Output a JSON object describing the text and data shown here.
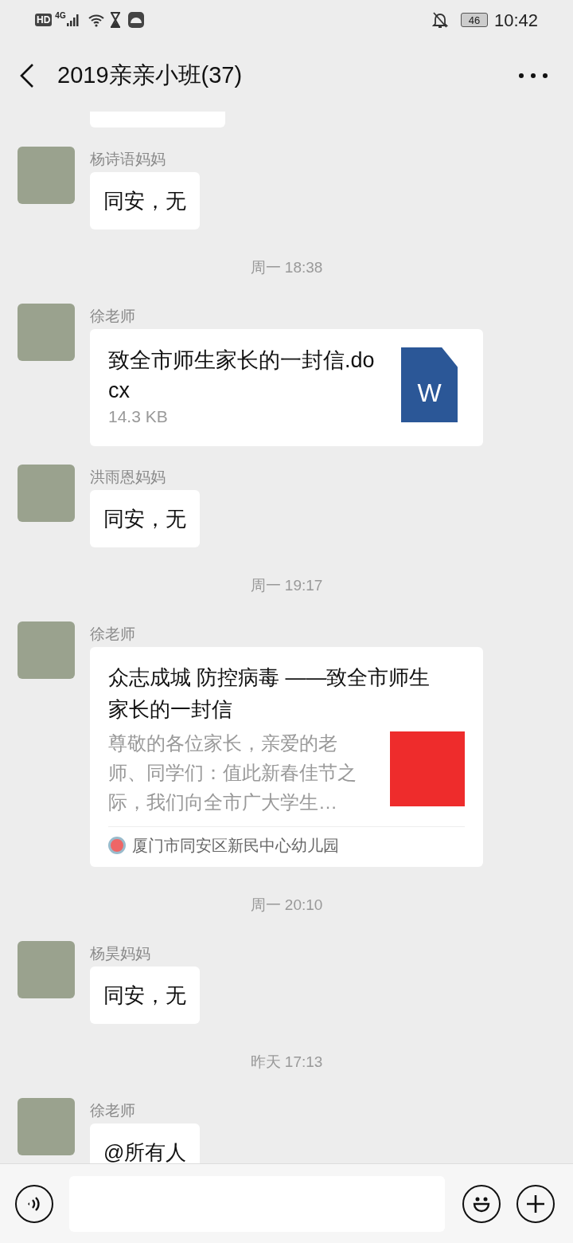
{
  "status_bar": {
    "hd": "HD",
    "network": "4G",
    "battery": "46",
    "time": "10:42"
  },
  "header": {
    "title": "2019亲亲小班(37)"
  },
  "messages": [
    {
      "kind": "partial"
    },
    {
      "kind": "text",
      "sender": "杨诗语妈妈",
      "text": "同安，无"
    },
    {
      "kind": "time",
      "text": "周一 18:38"
    },
    {
      "kind": "file",
      "sender": "徐老师",
      "file_name": "致全市师生家长的一封信.docx",
      "size": "14.3 KB",
      "file_badge": "W"
    },
    {
      "kind": "text",
      "sender": "洪雨恩妈妈",
      "text": "同安，无"
    },
    {
      "kind": "time",
      "text": "周一 19:17"
    },
    {
      "kind": "article",
      "sender": "徐老师",
      "title": "众志成城  防控病毒 ——致全市师生家长的一封信",
      "summary": "尊敬的各位家长，亲爱的老师、同学们：值此新春佳节之际，我们向全市广大学生…",
      "source": "厦门市同安区新民中心幼儿园"
    },
    {
      "kind": "time",
      "text": "周一 20:10"
    },
    {
      "kind": "text",
      "sender": "杨昊妈妈",
      "text": "同安，无"
    },
    {
      "kind": "time",
      "text": "昨天 17:13"
    },
    {
      "kind": "text",
      "sender": "徐老师",
      "text": "@所有人"
    }
  ]
}
